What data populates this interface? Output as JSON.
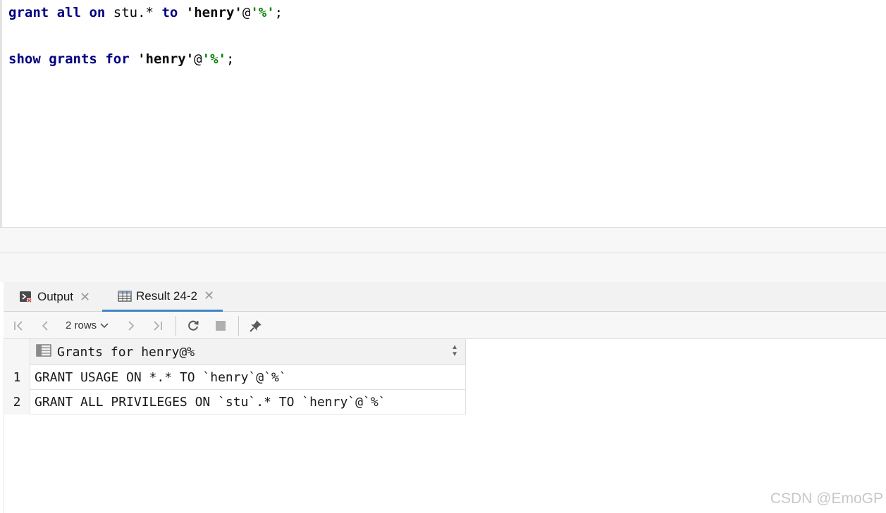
{
  "editor": {
    "line1": {
      "kw1": "grant",
      "kw2": "all",
      "kw3": "on",
      "ident": "stu.*",
      "kw4": "to",
      "user": "'henry'",
      "at": "@",
      "host": "'%'",
      "end": ";"
    },
    "line2": {
      "kw1": "show",
      "kw2": "grants",
      "kw3": "for",
      "user": "'henry'",
      "at": "@",
      "host": "'%'",
      "end": ";"
    }
  },
  "tabs": [
    {
      "label": "Output",
      "icon": "console-icon"
    },
    {
      "label": "Result 24-2",
      "icon": "table-icon",
      "active": true
    }
  ],
  "toolbar": {
    "rows_label": "2 rows"
  },
  "grid": {
    "column_header": "Grants for henry@%",
    "rows": [
      {
        "num": "1",
        "value": "GRANT USAGE ON *.* TO `henry`@`%`"
      },
      {
        "num": "2",
        "value": "GRANT ALL PRIVILEGES ON `stu`.* TO `henry`@`%`"
      }
    ]
  },
  "watermark": "CSDN @EmoGP",
  "colors": {
    "keyword": "#000080",
    "string": "#008000",
    "accent": "#4083c9"
  }
}
